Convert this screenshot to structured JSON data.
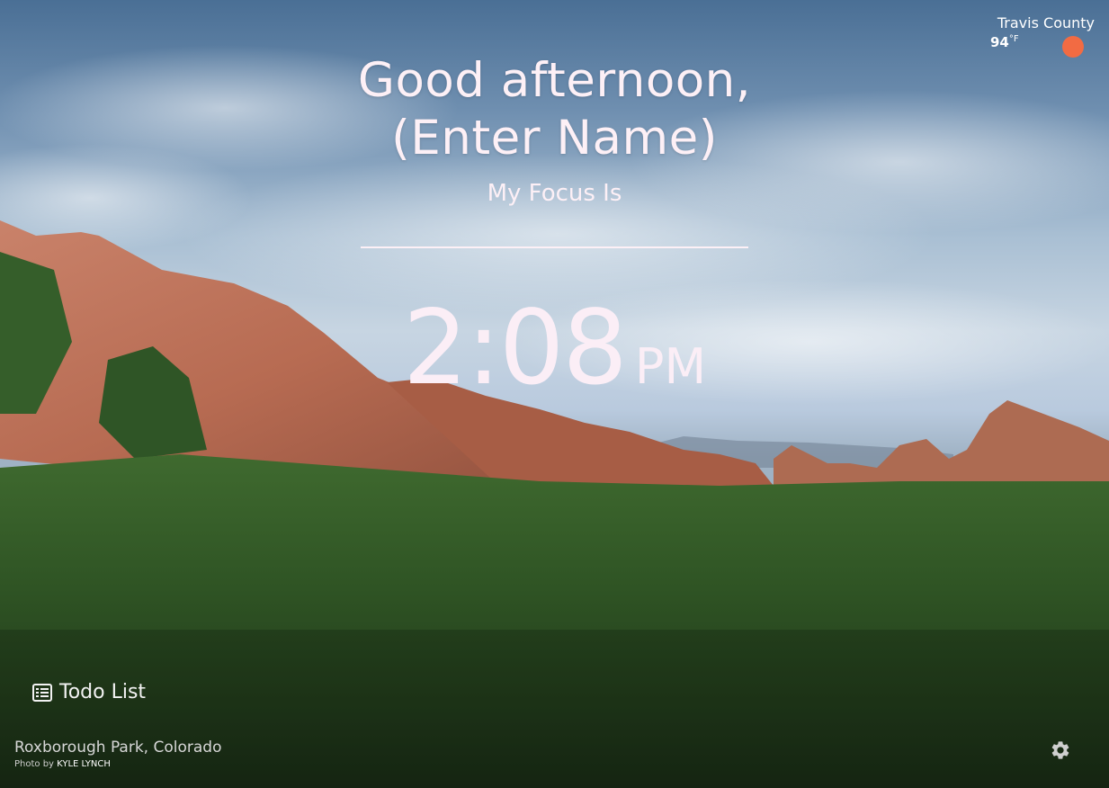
{
  "weather": {
    "location": "Travis County",
    "temperature": "94",
    "unit": "°F",
    "icon": "sun-icon",
    "icon_color": "#f26b43"
  },
  "greeting": {
    "line1": "Good afternoon,",
    "line2": "(Enter Name)"
  },
  "focus": {
    "label": "My Focus Is",
    "value": ""
  },
  "clock": {
    "time": "2:08",
    "ampm": "PM"
  },
  "todo": {
    "label": "Todo List",
    "icon": "list-icon"
  },
  "photo": {
    "location": "Roxborough Park, Colorado",
    "by_prefix": "Photo by ",
    "author": "KYLE LYNCH"
  },
  "settings": {
    "icon": "gear-icon"
  },
  "colors": {
    "text": "#fdf0f6",
    "weather_sun": "#f26b43"
  }
}
